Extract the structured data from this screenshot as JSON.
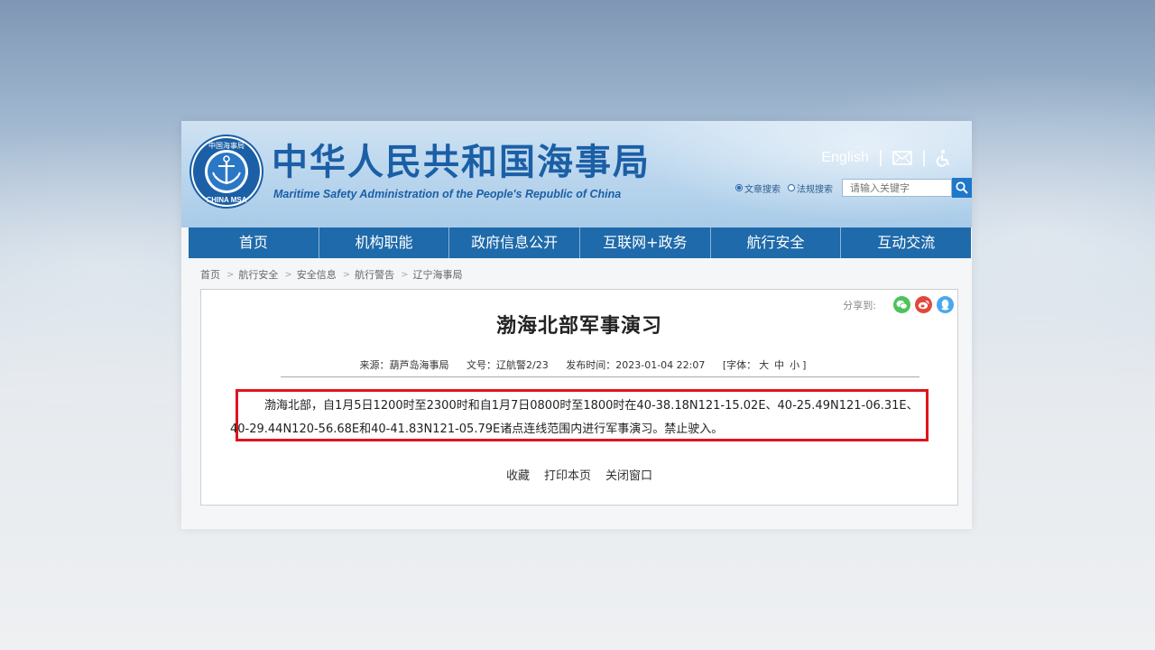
{
  "header": {
    "logo": {
      "ring_top_text": "中国海事局",
      "ring_bottom_text": "CHINA MSA"
    },
    "title_cn": "中华人民共和国海事局",
    "title_en": "Maritime Safety Administration of the People's Republic of China",
    "english_link": "English",
    "sep1": "|",
    "sep2": "|",
    "search": {
      "option_article": "文章搜索",
      "option_law": "法规搜索",
      "placeholder": "请输入关键字"
    }
  },
  "nav": {
    "items": [
      "首页",
      "机构职能",
      "政府信息公开",
      "互联网+政务",
      "航行安全",
      "互动交流"
    ]
  },
  "breadcrumb": {
    "items": [
      "首页",
      "航行安全",
      "安全信息",
      "航行警告",
      "辽宁海事局"
    ]
  },
  "article": {
    "share_label": "分享到:",
    "title": "渤海北部军事演习",
    "meta": {
      "source": "来源：葫芦岛海事局",
      "doc_no": "文号：辽航警2/23",
      "published": "发布时间：2023-01-04 22:07",
      "font_label": "[字体：",
      "font_large": "大",
      "font_medium": "中",
      "font_small": "小",
      "font_close": "]"
    },
    "body": "渤海北部，自1月5日1200时至2300时和自1月7日0800时至1800时在40-38.18N121-15.02E、40-25.49N121-06.31E、40-29.44N120-56.68E和40-41.83N121-05.79E诸点连线范围内进行军事演习。禁止驶入。",
    "actions": {
      "favorite": "收藏",
      "print": "打印本页",
      "close": "关闭窗口"
    }
  },
  "colors": {
    "brand_blue": "#1b5fa6",
    "nav_blue": "#1e6aaa",
    "highlight_red": "#e0141e",
    "share_wechat": "#4cc35b",
    "share_weibo": "#e2473c",
    "share_qq": "#4aa8ee"
  },
  "icons": [
    "mail-icon",
    "accessibility-icon",
    "search-icon",
    "wechat-icon",
    "weibo-icon",
    "qq-icon"
  ]
}
